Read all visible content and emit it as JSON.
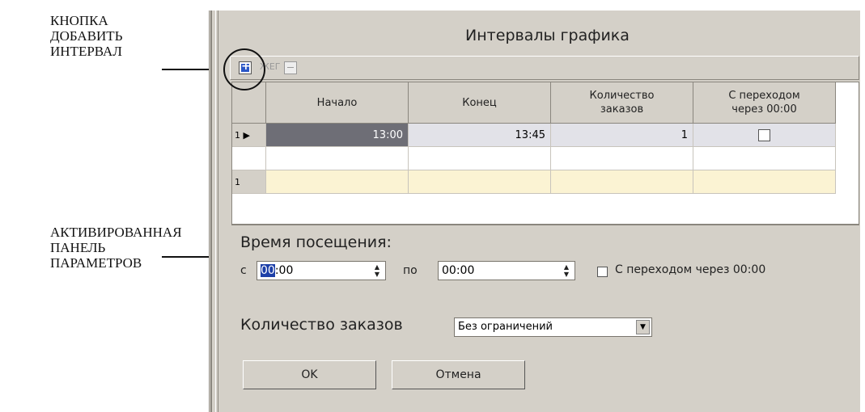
{
  "callouts": {
    "add_interval": [
      "КНОПКА",
      "ДОБАВИТЬ",
      "ИНТЕРВАЛ"
    ],
    "active_panel": [
      "АКТИВИРОВАННАЯ",
      "ПАНЕЛЬ",
      "ПАРАМЕТРОВ"
    ]
  },
  "window": {
    "title": "Интервалы графика"
  },
  "toolbar": {
    "edit_glyph": "ЖЕГ"
  },
  "grid": {
    "headers": [
      "Начало",
      "Конец",
      "Количество заказов",
      "С переходом через 00:00"
    ],
    "rows": [
      {
        "num": "1",
        "start": "13:00",
        "end": "13:45",
        "count": "1",
        "midnight": false
      }
    ],
    "new_row_num": "1"
  },
  "params": {
    "visit_time_label": "Время посещения:",
    "from_label": "с",
    "from_value_hours": "00",
    "from_value_rest": ":00",
    "to_label": "по",
    "to_value": "00:00",
    "midnight_label": "С переходом через 00:00",
    "orders_label": "Количество заказов",
    "orders_value": "Без ограничений",
    "ok_label": "OK",
    "cancel_label": "Отмена"
  }
}
